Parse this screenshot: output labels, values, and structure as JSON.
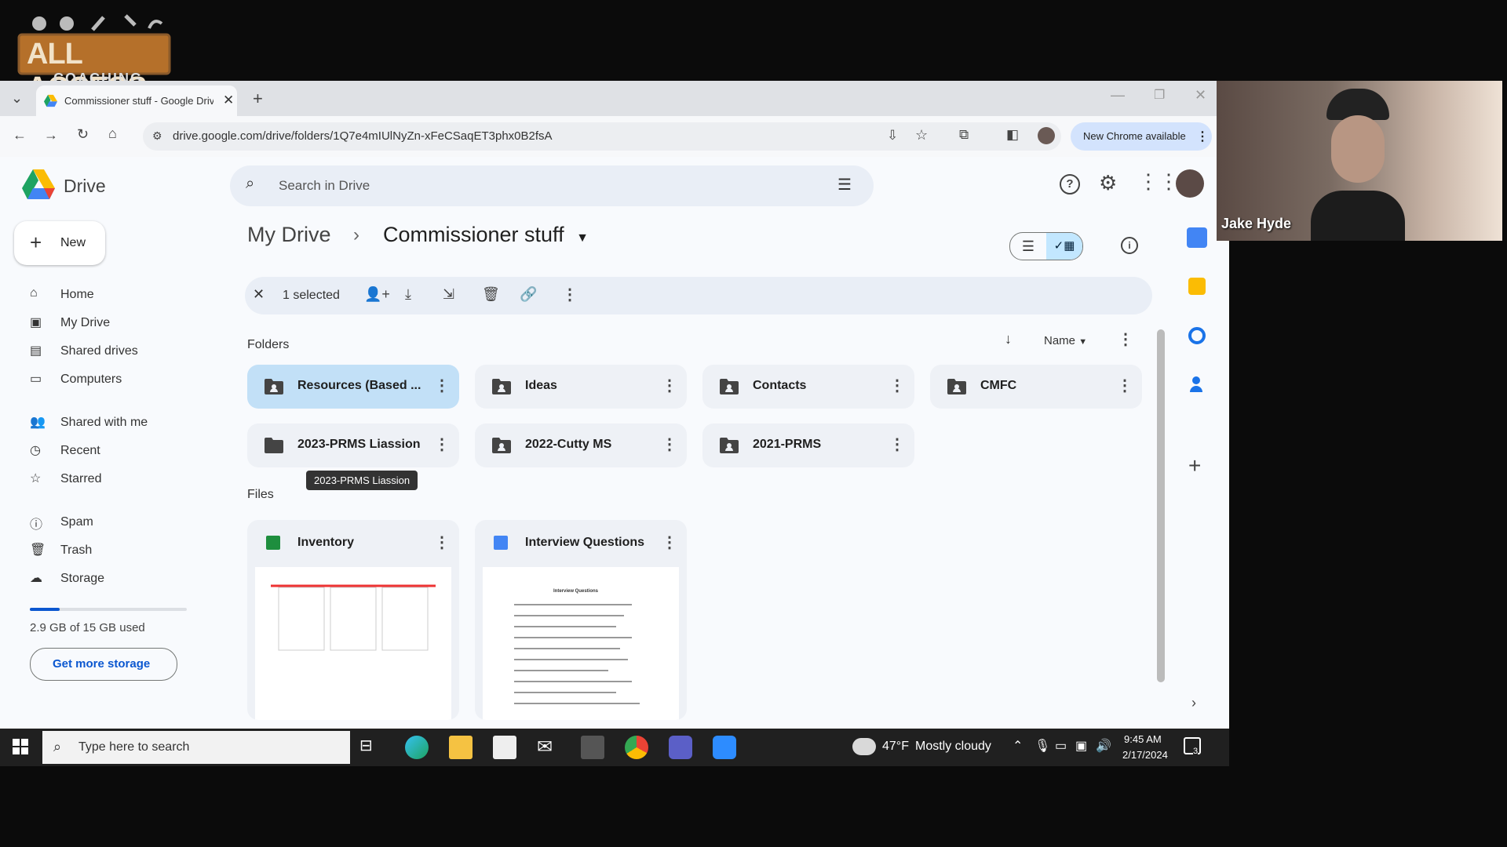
{
  "logo": {
    "line1": "ALL ACCESS",
    "line2": "COACHING"
  },
  "browser": {
    "tab_title": "Commissioner stuff - Google Drive",
    "new_tab": "+",
    "url": "drive.google.com/drive/folders/1Q7e4mIUlNyZn-xFeCSaqET3phx0B2fsA",
    "new_chrome": "New Chrome available"
  },
  "drive": {
    "app_name": "Drive",
    "search_placeholder": "Search in Drive",
    "new_button": "New",
    "breadcrumb": {
      "root": "My Drive",
      "separator": "›",
      "current": "Commissioner stuff"
    },
    "selection": {
      "count_label": "1 selected"
    },
    "sort": {
      "label": "Name"
    },
    "sections": {
      "folders": "Folders",
      "files": "Files"
    },
    "nav": [
      {
        "label": "Home",
        "icon": "home-icon"
      },
      {
        "label": "My Drive",
        "icon": "my-drive-icon"
      },
      {
        "label": "Shared drives",
        "icon": "shared-drives-icon"
      },
      {
        "label": "Computers",
        "icon": "computers-icon"
      },
      {
        "label": "Shared with me",
        "icon": "shared-with-me-icon"
      },
      {
        "label": "Recent",
        "icon": "clock-icon"
      },
      {
        "label": "Starred",
        "icon": "star-icon"
      },
      {
        "label": "Spam",
        "icon": "spam-icon"
      },
      {
        "label": "Trash",
        "icon": "trash-icon"
      },
      {
        "label": "Storage",
        "icon": "cloud-icon"
      }
    ],
    "storage": {
      "used_text": "2.9 GB of 15 GB used",
      "used_fraction": 0.19,
      "button": "Get more storage"
    },
    "folders": [
      {
        "name": "Resources (Based ...",
        "selected": true,
        "shared": true
      },
      {
        "name": "Ideas",
        "selected": false,
        "shared": true
      },
      {
        "name": "Contacts",
        "selected": false,
        "shared": true
      },
      {
        "name": "CMFC",
        "selected": false,
        "shared": true
      },
      {
        "name": "2023-PRMS Liassion",
        "selected": false,
        "shared": false
      },
      {
        "name": "2022-Cutty MS",
        "selected": false,
        "shared": true
      },
      {
        "name": "2021-PRMS",
        "selected": false,
        "shared": true
      }
    ],
    "tooltip": "2023-PRMS Liassion",
    "files": [
      {
        "name": "Inventory",
        "type": "sheets"
      },
      {
        "name": "Interview Questions",
        "type": "docs",
        "preview_title": "Interview Questions"
      }
    ],
    "colors": {
      "accent": "#0b57d0",
      "selected": "#c2e0f7",
      "sheets": "#1e8e3e",
      "docs": "#4285f4"
    }
  },
  "taskbar": {
    "search_placeholder": "Type here to search",
    "weather_temp": "47°F",
    "weather_text": "Mostly cloudy",
    "time": "9:45 AM",
    "date": "2/17/2024",
    "notification_count": "3"
  },
  "webcam": {
    "participant_name": "Jake Hyde"
  }
}
